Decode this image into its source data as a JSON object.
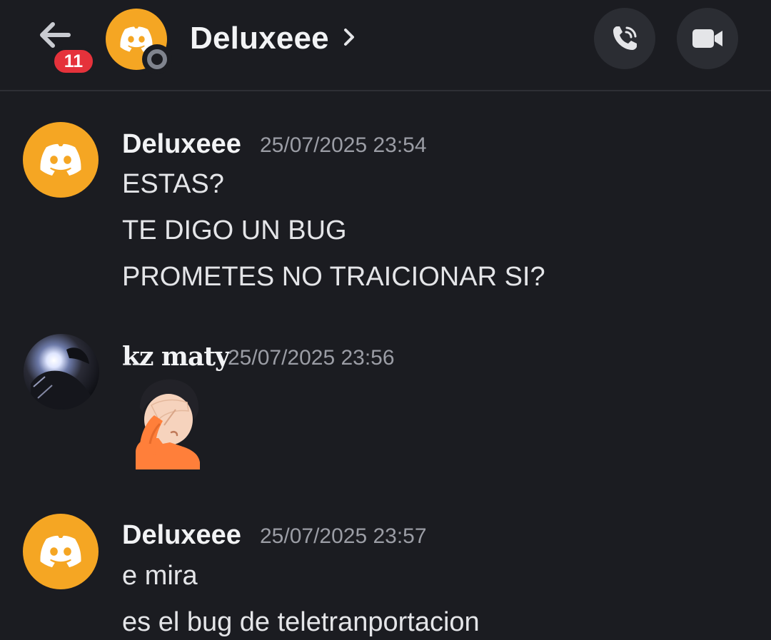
{
  "header": {
    "back_badge": "11",
    "title": "Deluxeee",
    "status": "offline",
    "icons": {
      "back": "arrow-left-icon",
      "chevron": "chevron-right-icon",
      "call": "phone-icon",
      "video": "video-camera-icon",
      "avatar": "discord-logo-icon"
    }
  },
  "colors": {
    "background": "#1b1c21",
    "avatar_yellow": "#f5a623",
    "badge_red": "#e5323b",
    "button_bg": "#2b2d33",
    "timestamp": "#9b9da5"
  },
  "messages": [
    {
      "author": "Deluxeee",
      "timestamp": "25/07/2025 23:54",
      "avatar": "discord-logo-icon",
      "lines": [
        "ESTAS?",
        "TE DIGO UN BUG",
        "PROMETES NO TRAICIONAR SI?"
      ]
    },
    {
      "author": "kz maty",
      "timestamp": "25/07/2025 23:56",
      "avatar": "user-photo",
      "emoji": "person-facepalming"
    },
    {
      "author": "Deluxeee",
      "timestamp": "25/07/2025 23:57",
      "avatar": "discord-logo-icon",
      "lines": [
        "e mira",
        "es el bug de teletranportacion"
      ]
    }
  ]
}
